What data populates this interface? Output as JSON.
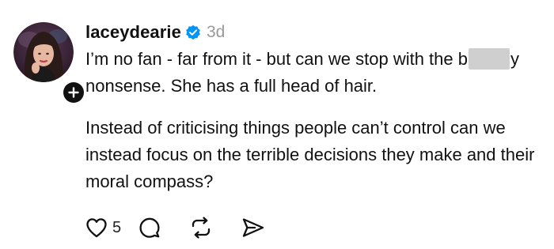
{
  "post": {
    "username": "laceydearie",
    "verified": true,
    "timestamp": "3d",
    "paragraph1": {
      "before": "I’m no fan - far from it - but can we stop with the b",
      "after": "y nonsense. She has a full head of hair."
    },
    "paragraph2": "Instead of criticising things people can’t control can we instead focus on the terrible decisions they make and their moral compass?",
    "like_count": "5"
  },
  "icons": {
    "verified": "verified-badge-icon",
    "follow": "plus-icon",
    "like": "heart-icon",
    "reply": "comment-bubble-icon",
    "repost": "repost-arrows-icon",
    "share": "send-icon"
  },
  "colors": {
    "verified_blue": "#0095f6",
    "timestamp_gray": "#9a9a9a",
    "text": "#111111"
  }
}
